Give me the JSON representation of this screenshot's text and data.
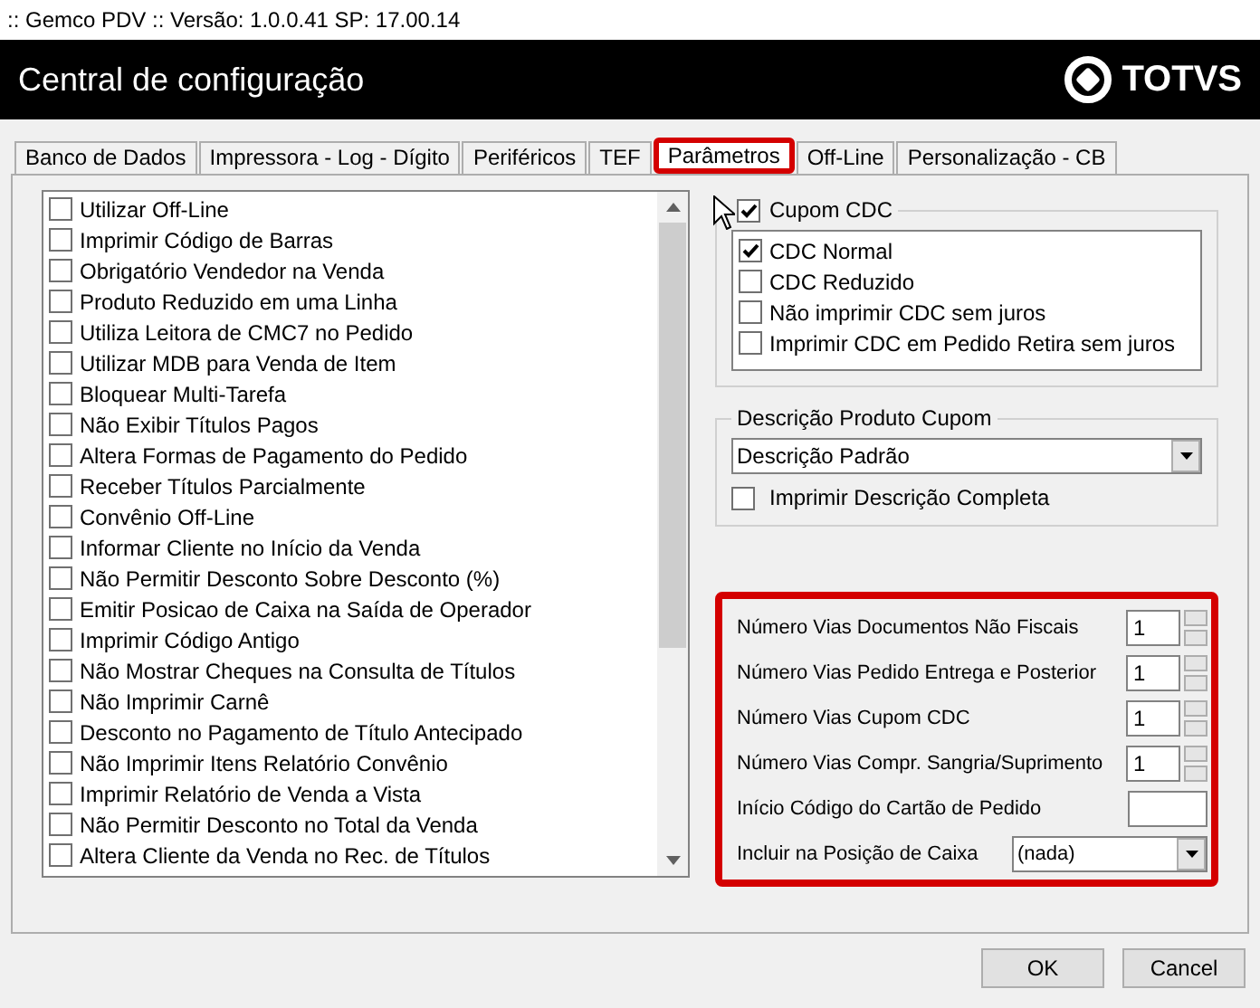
{
  "window": {
    "title": ":: Gemco PDV :: Versão: 1.0.0.41 SP: 17.00.14"
  },
  "header": {
    "title": "Central de configuração",
    "logo_text": "TOTVS"
  },
  "tabs": [
    {
      "label": "Banco de Dados",
      "selected": false,
      "highlighted": false
    },
    {
      "label": "Impressora - Log - Dígito",
      "selected": false,
      "highlighted": false
    },
    {
      "label": "Periféricos",
      "selected": false,
      "highlighted": false
    },
    {
      "label": "TEF",
      "selected": false,
      "highlighted": false
    },
    {
      "label": "Parâmetros",
      "selected": true,
      "highlighted": true
    },
    {
      "label": "Off-Line",
      "selected": false,
      "highlighted": false
    },
    {
      "label": "Personalização - CB",
      "selected": false,
      "highlighted": false
    }
  ],
  "options": [
    {
      "label": "Utilizar Off-Line",
      "checked": false
    },
    {
      "label": "Imprimir Código de Barras",
      "checked": false
    },
    {
      "label": "Obrigatório Vendedor na Venda",
      "checked": false
    },
    {
      "label": "Produto Reduzido em uma Linha",
      "checked": false
    },
    {
      "label": "Utiliza Leitora de CMC7 no Pedido",
      "checked": false
    },
    {
      "label": "Utilizar MDB para Venda de Item",
      "checked": false
    },
    {
      "label": "Bloquear Multi-Tarefa",
      "checked": false
    },
    {
      "label": "Não Exibir Títulos Pagos",
      "checked": false
    },
    {
      "label": "Altera Formas de Pagamento do Pedido",
      "checked": false
    },
    {
      "label": "Receber Títulos Parcialmente",
      "checked": false
    },
    {
      "label": "Convênio Off-Line",
      "checked": false
    },
    {
      "label": "Informar Cliente no Início da Venda",
      "checked": false
    },
    {
      "label": "Não Permitir Desconto Sobre Desconto (%)",
      "checked": false
    },
    {
      "label": "Emitir Posicao de Caixa na Saída de Operador",
      "checked": false
    },
    {
      "label": "Imprimir Código Antigo",
      "checked": false
    },
    {
      "label": "Não Mostrar Cheques na Consulta de Títulos",
      "checked": false
    },
    {
      "label": "Não Imprimir Carnê",
      "checked": false
    },
    {
      "label": "Desconto no Pagamento de Título Antecipado",
      "checked": false
    },
    {
      "label": "Não Imprimir Itens Relatório Convênio",
      "checked": false
    },
    {
      "label": "Imprimir Relatório de Venda a Vista",
      "checked": false
    },
    {
      "label": "Não Permitir Desconto no Total da Venda",
      "checked": false
    },
    {
      "label": "Altera Cliente da Venda no Rec. de Títulos",
      "checked": false
    }
  ],
  "cupom_cdc": {
    "label": "Cupom CDC",
    "checked": true,
    "items": [
      {
        "label": "CDC Normal",
        "checked": true
      },
      {
        "label": "CDC Reduzido",
        "checked": false
      },
      {
        "label": "Não imprimir CDC sem juros",
        "checked": false
      },
      {
        "label": "Imprimir CDC em Pedido Retira sem juros",
        "checked": false
      }
    ]
  },
  "descricao": {
    "title": "Descrição Produto Cupom",
    "value": "Descrição Padrão",
    "option": {
      "label": "Imprimir Descrição Completa",
      "checked": false
    }
  },
  "fields": [
    {
      "kind": "spin",
      "label": "Número Vias Documentos Não Fiscais",
      "value": "1"
    },
    {
      "kind": "spin",
      "label": "Número Vias Pedido Entrega e Posterior",
      "value": "1"
    },
    {
      "kind": "spin",
      "label": "Número Vias Cupom CDC",
      "value": "1"
    },
    {
      "kind": "spin",
      "label": "Número Vias Compr. Sangria/Suprimento",
      "value": "1"
    },
    {
      "kind": "text",
      "label": "Início Código do Cartão de Pedido"
    },
    {
      "kind": "select",
      "label": "Incluir na Posição de Caixa",
      "value": "(nada)"
    }
  ],
  "fields_highlighted": true,
  "buttons": [
    "OK",
    "Cancel"
  ]
}
